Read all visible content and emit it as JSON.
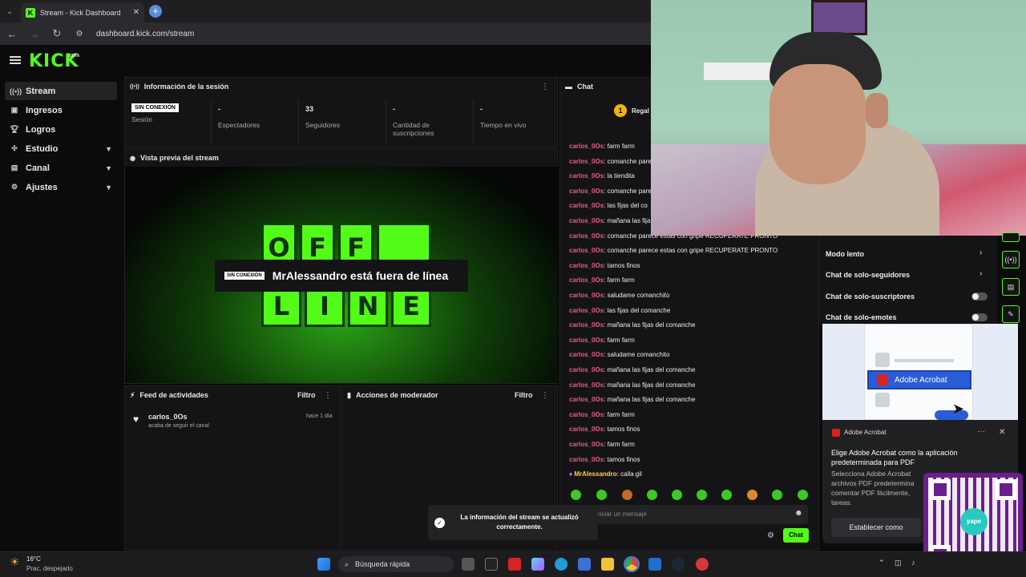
{
  "browser": {
    "tab_title": "Stream - Kick Dashboard",
    "tab_close": "✕",
    "new_tab": "+",
    "url": "dashboard.kick.com/stream"
  },
  "brand": {
    "logo": "KICK",
    "beta": "BETA",
    "accent": "#53fc18"
  },
  "sidebar": {
    "items": [
      {
        "label": "Stream",
        "icon": "broadcast-icon"
      },
      {
        "label": "Ingresos",
        "icon": "money-icon"
      },
      {
        "label": "Logros",
        "icon": "trophy-icon"
      },
      {
        "label": "Estudio",
        "icon": "studio-icon"
      },
      {
        "label": "Canal",
        "icon": "channel-icon"
      },
      {
        "label": "Ajustes",
        "icon": "gear-icon"
      }
    ]
  },
  "session": {
    "title": "Información de la sesión",
    "status_badge": "SIN CONEXIÓN",
    "stats": [
      {
        "value": "",
        "label": "Sesión"
      },
      {
        "value": "-",
        "label": "Espectadores"
      },
      {
        "value": "33",
        "label": "Seguidores"
      },
      {
        "value": "-",
        "label": "Cantidad de suscripciones"
      },
      {
        "value": "-",
        "label": "Tiempo en vivo"
      }
    ]
  },
  "preview": {
    "title": "Vista previa del stream",
    "offline_badge": "SIN CONEXIÓN",
    "offline_text": "MrAlessandro está fuera de línea",
    "tile_text_top": [
      "O",
      "F",
      "F"
    ],
    "tile_text_bottom": [
      "L",
      "I",
      "N",
      "E"
    ]
  },
  "activity": {
    "title": "Feed de actividades",
    "filter": "Filtro",
    "items": [
      {
        "user": "carlos_0Os",
        "desc": "acaba de seguir el canal",
        "time": "hace 1 día"
      }
    ]
  },
  "moderator": {
    "title": "Acciones de moderador",
    "filter": "Filtro"
  },
  "chat": {
    "title": "Chat",
    "gift_label": "Regal",
    "messages": [
      {
        "user": "carlos_0Os",
        "text": "farm farm"
      },
      {
        "user": "carlos_0Os",
        "text": "comanche pare"
      },
      {
        "user": "carlos_0Os",
        "text": "la tiendita"
      },
      {
        "user": "carlos_0Os",
        "text": "comanche pare"
      },
      {
        "user": "carlos_0Os",
        "text": "las fijas del co"
      },
      {
        "user": "carlos_0Os",
        "text": "mañana las fija"
      },
      {
        "user": "carlos_0Os",
        "text": "comanche parece estas con gripe RECUPERATE PRONTO"
      },
      {
        "user": "carlos_0Os",
        "text": "comanche parece estas con gripe RECUPERATE PRONTO"
      },
      {
        "user": "carlos_0Os",
        "text": "tamos finos"
      },
      {
        "user": "carlos_0Os",
        "text": "farm farm"
      },
      {
        "user": "carlos_0Os",
        "text": "saludame comanchito"
      },
      {
        "user": "carlos_0Os",
        "text": "las fijas del comanche"
      },
      {
        "user": "carlos_0Os",
        "text": "mañana las fijas del comanche"
      },
      {
        "user": "carlos_0Os",
        "text": "farm farm"
      },
      {
        "user": "carlos_0Os",
        "text": "saludame comanchito"
      },
      {
        "user": "carlos_0Os",
        "text": "mañana las fijas del comanche"
      },
      {
        "user": "carlos_0Os",
        "text": "mañana las fijas del comanche"
      },
      {
        "user": "carlos_0Os",
        "text": "mañana las fijas del comanche"
      },
      {
        "user": "carlos_0Os",
        "text": "farm farm"
      },
      {
        "user": "carlos_0Os",
        "text": "tamos finos"
      },
      {
        "user": "carlos_0Os",
        "text": "farm farm"
      },
      {
        "user": "carlos_0Os",
        "text": "tamos finos"
      },
      {
        "user": "MrAlessandro",
        "text": "calla gil"
      }
    ],
    "input_placeholder": "nviar un mensaje",
    "send_label": "Chat"
  },
  "chat_settings": {
    "slow_mode": "Modo lento",
    "followers_only": "Chat de solo-seguidores",
    "subs_only": "Chat de solo-suscriptores",
    "emotes_only": "Chat de solo-emotes"
  },
  "acrobat": {
    "menu_item": "Adobe Acrobat",
    "app_name": "Adobe Acrobat",
    "title": "Elige Adobe Acrobat como la aplicación predeterminada para PDF",
    "body": "Selecciona Adobe Acrobat archivos PDF predetermina comentar PDF fácilmente, tareas.",
    "button": "Establecer como"
  },
  "toast": {
    "text": "La información del stream se actualizó correctamente."
  },
  "taskbar": {
    "weather_temp": "16°C",
    "weather_desc": "Prac. despejado",
    "search": "Búsqueda rápida"
  },
  "qr": {
    "brand": "yape"
  }
}
